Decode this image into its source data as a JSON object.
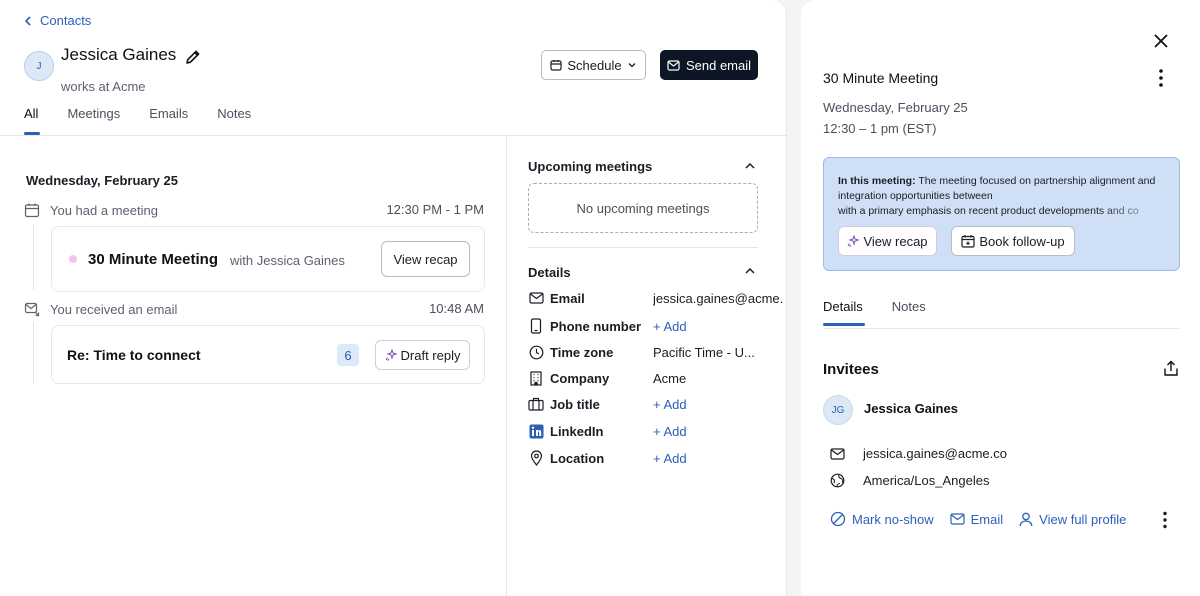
{
  "contact": {
    "back_label": "Contacts",
    "initial": "J",
    "name": "Jessica Gaines",
    "works_at": "works at Acme",
    "schedule_label": "Schedule",
    "send_email_label": "Send email"
  },
  "tabs": [
    {
      "label": "All"
    },
    {
      "label": "Meetings"
    },
    {
      "label": "Emails"
    },
    {
      "label": "Notes"
    }
  ],
  "timeline": {
    "date": "Wednesday, February 25",
    "meeting_event": {
      "text": "You had a meeting",
      "time": "12:30 PM - 1 PM",
      "title": "30 Minute Meeting",
      "with": "with Jessica Gaines",
      "action": "View recap"
    },
    "email_event": {
      "text": "You received an email",
      "time": "10:48 AM",
      "subject": "Re: Time to connect",
      "count": "6",
      "action": "Draft reply"
    }
  },
  "upcoming": {
    "title": "Upcoming meetings",
    "empty": "No upcoming meetings"
  },
  "details": {
    "title": "Details",
    "rows": [
      {
        "icon": "mail-icon",
        "label": "Email",
        "value": "jessica.gaines@acme.co"
      },
      {
        "icon": "phone-icon",
        "label": "Phone number",
        "value": "+ Add"
      },
      {
        "icon": "clock-icon",
        "label": "Time zone",
        "value": "Pacific Time - U..."
      },
      {
        "icon": "building-icon",
        "label": "Company",
        "value": "Acme"
      },
      {
        "icon": "briefcase-icon",
        "label": "Job title",
        "value": "+ Add"
      },
      {
        "icon": "linkedin-icon",
        "label": "LinkedIn",
        "value": "+ Add"
      },
      {
        "icon": "location-pin-icon",
        "label": "Location",
        "value": "+ Add"
      }
    ]
  },
  "panel": {
    "title": "30 Minute Meeting",
    "date": "Wednesday, February 25",
    "time": "12:30 – 1 pm (EST)",
    "summary_label": "In this meeting:",
    "summary_text": " The meeting focused on partnership alignment and integration opportunities between",
    "summary_text2": "with a primary emphasis on recent product developments and co",
    "view_recap": "View recap",
    "book_followup": "Book follow-up",
    "tabs": [
      {
        "label": "Details"
      },
      {
        "label": "Notes"
      }
    ],
    "invitees_title": "Invitees",
    "invitee": {
      "initials": "JG",
      "name": "Jessica Gaines",
      "email": "jessica.gaines@acme.co",
      "timezone": "America/Los_Angeles"
    },
    "actions": {
      "mark_noshow": "Mark no-show",
      "email": "Email",
      "view_profile": "View full profile"
    }
  },
  "colors": {
    "accent": "#2b5fb8",
    "primary_button": "#0c1624",
    "summary_bg": "#cfe0f6"
  }
}
